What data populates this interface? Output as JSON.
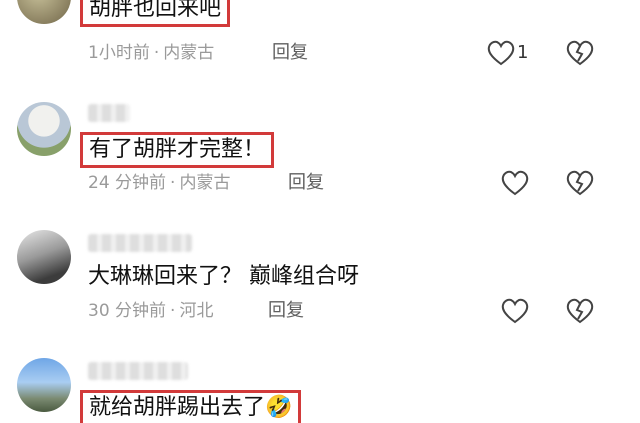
{
  "comments": [
    {
      "text": "胡胖也回来吧",
      "time": "1小时前",
      "location": "内蒙古",
      "reply_label": "回复",
      "like_count": "1",
      "highlighted": true
    },
    {
      "text": "有了胡胖才完整！",
      "time": "24 分钟前",
      "location": "内蒙古",
      "reply_label": "回复",
      "like_count": "",
      "highlighted": true
    },
    {
      "text": "大琳琳回来了？ 巅峰组合呀",
      "time": "30 分钟前",
      "location": "河北",
      "reply_label": "回复",
      "like_count": "",
      "highlighted": false
    },
    {
      "text": "就给胡胖踢出去了🤣",
      "highlighted": true
    }
  ],
  "meta_separator": "·",
  "colors": {
    "highlight_box": "#d23a3a",
    "meta_text": "#9a9a9a",
    "reply_text": "#5f5f5f"
  }
}
